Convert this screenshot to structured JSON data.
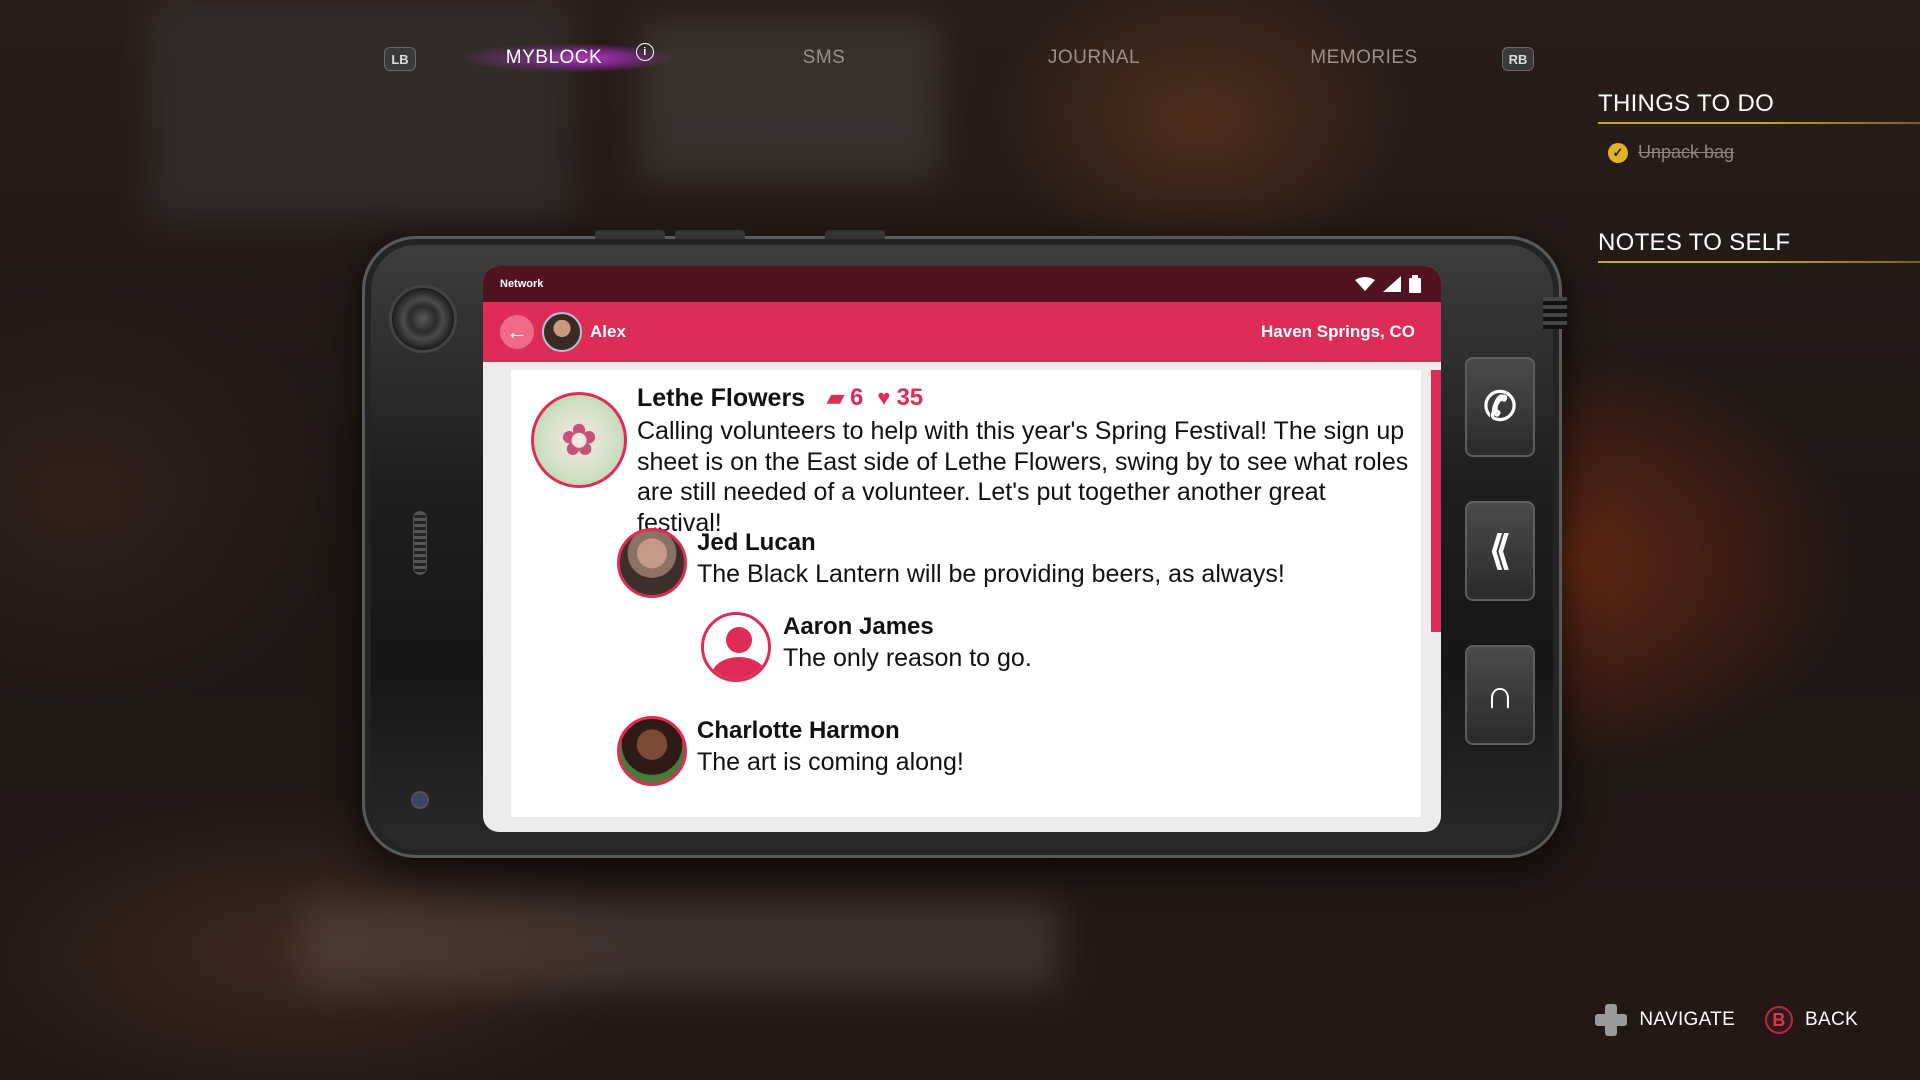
{
  "nav": {
    "left_bumper": "LB",
    "right_bumper": "RB",
    "tabs": [
      {
        "label": "MYBLOCK",
        "active": true,
        "has_info": true
      },
      {
        "label": "SMS",
        "active": false
      },
      {
        "label": "JOURNAL",
        "active": false
      },
      {
        "label": "MEMORIES",
        "active": false
      }
    ],
    "info_glyph": "i"
  },
  "side_panel": {
    "things_to_do_title": "THINGS TO DO",
    "todos": [
      {
        "label": "Unpack bag",
        "done": true
      }
    ],
    "notes_title": "NOTES TO SELF"
  },
  "phone": {
    "status": {
      "network_label": "Network",
      "icons": [
        "wifi-icon",
        "signal-icon",
        "battery-icon"
      ]
    },
    "header": {
      "user_name": "Alex",
      "location": "Haven Springs, CO",
      "back_glyph": "←"
    },
    "post": {
      "author": "Lethe Flowers",
      "comment_count": "6",
      "like_count": "35",
      "text": "Calling volunteers to help with this year's Spring Festival! The sign up sheet is on the East side of Lethe Flowers, swing by to see what roles are still needed of a volunteer. Let's put together another great festival!",
      "replies": [
        {
          "author": "Jed Lucan",
          "text": "The Black Lantern will be providing beers, as always!"
        },
        {
          "author": "Aaron James",
          "text": "The only reason to go."
        },
        {
          "author": "Charlotte Harmon",
          "text": "The art is coming along!"
        }
      ]
    },
    "actions": [
      {
        "icon": "phone-call-icon",
        "glyph": "✆"
      },
      {
        "icon": "app-switch-icon",
        "glyph": "⟪"
      },
      {
        "icon": "return-icon",
        "glyph": "∩"
      }
    ]
  },
  "prompts": {
    "navigate_label": "NAVIGATE",
    "back_label": "BACK",
    "back_button_glyph": "B"
  },
  "colors": {
    "accent": "#dd2c55",
    "status_bar": "#51131f",
    "active_tab_glow": "#cc3cdc",
    "todo_check": "#e0b425"
  }
}
